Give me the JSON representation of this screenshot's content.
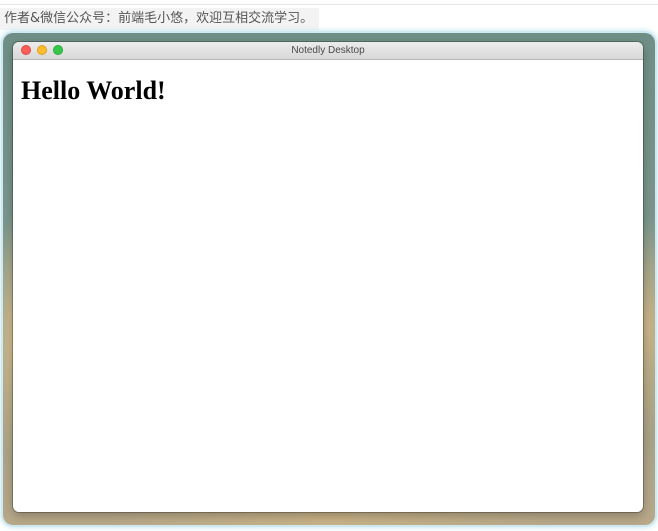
{
  "caption": "作者&微信公众号：前端毛小悠，欢迎互相交流学习。",
  "window": {
    "title": "Notedly Desktop",
    "controls": {
      "close_color": "#fc5f57",
      "minimize_color": "#fdbc2e",
      "maximize_color": "#34c84a"
    }
  },
  "content": {
    "heading": "Hello World!"
  }
}
